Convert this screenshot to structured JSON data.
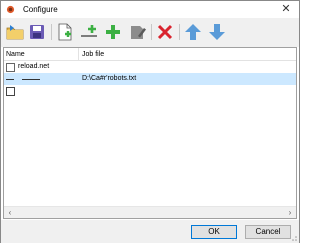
{
  "window": {
    "title": "Configure",
    "close_glyph": "✕"
  },
  "toolbar": {
    "buttons": [
      {
        "icon": "open-folder-icon"
      },
      {
        "icon": "save-disk-icon"
      },
      {
        "icon": "new-document-icon"
      },
      {
        "icon": "add-separator-icon"
      },
      {
        "icon": "add-item-icon"
      },
      {
        "icon": "edit-item-icon"
      },
      {
        "icon": "delete-icon"
      },
      {
        "icon": "move-up-icon"
      },
      {
        "icon": "move-down-icon"
      }
    ]
  },
  "grid": {
    "columns": [
      "Name",
      "Job file"
    ],
    "rows": [
      {
        "name": "reload.net",
        "job": "",
        "checked": false
      },
      {
        "name": "",
        "job": "D:\\Ca#r'robots.txt",
        "checked": false,
        "selected": true
      },
      {
        "name": "",
        "job": "",
        "checked": false
      }
    ]
  },
  "footer": {
    "ok_label": "OK",
    "cancel_label": "Cancel"
  },
  "colors": {
    "selection": "#cce8ff",
    "toolbar_bg": "#f0f0f0",
    "accent_blue": "#0078d7",
    "green": "#3cb043",
    "red": "#d9232e"
  }
}
